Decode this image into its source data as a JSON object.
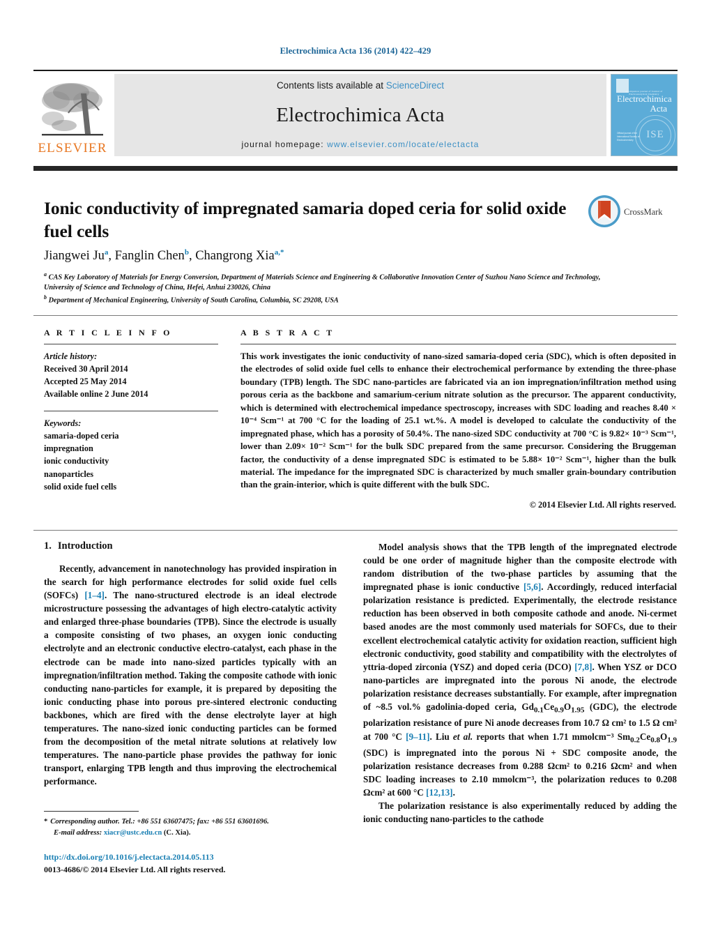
{
  "running_head": "Electrochimica Acta 136 (2014) 422–429",
  "masthead": {
    "publisher": "ELSEVIER",
    "contents_prefix": "Contents lists available at ",
    "contents_link": "ScienceDirect",
    "journal_title": "Electrochimica Acta",
    "homepage_prefix": "journal homepage: ",
    "homepage_url": "www.elsevier.com/locate/electacta",
    "cover": {
      "line1": "Electrochimica",
      "line2": "Acta",
      "tiny_top": "a companion journal of Journal of Electroanalytical Chemistry",
      "tiny_blurb": "Official journal of the International Society of Electrochemistry",
      "society": "ISE"
    }
  },
  "article": {
    "title": "Ionic conductivity of impregnated samaria doped ceria for solid oxide fuel cells",
    "crossmark_label": "CrossMark",
    "authors_html": "Jiangwei Ju<sup>a</sup>, Fanglin Chen<sup>b</sup>, Changrong Xia<sup>a,*</sup>",
    "affiliation_a": "CAS Key Laboratory of Materials for Energy Conversion, Department of Materials Science and Engineering & Collaborative Innovation Center of Suzhou Nano Science and Technology, University of Science and Technology of China, Hefei, Anhui 230026, China",
    "affiliation_b": "Department of Mechanical Engineering, University of South Carolina, Columbia, SC 29208, USA"
  },
  "article_info": {
    "heading": "A R T I C L E   I N F O",
    "history_title": "Article history:",
    "history": [
      "Received 30 April 2014",
      "Accepted 25 May 2014",
      "Available online 2 June 2014"
    ],
    "keywords_title": "Keywords:",
    "keywords": [
      "samaria-doped ceria",
      "impregnation",
      "ionic conductivity",
      "nanoparticles",
      "solid oxide fuel cells"
    ]
  },
  "abstract": {
    "heading": "A B S T R A C T",
    "text": "This work investigates the ionic conductivity of nano-sized samaria-doped ceria (SDC), which is often deposited in the electrodes of solid oxide fuel cells to enhance their electrochemical performance by extending the three-phase boundary (TPB) length. The SDC nano-particles are fabricated via an ion impregnation/infiltration method using porous ceria as the backbone and samarium-cerium nitrate solution as the precursor. The apparent conductivity, which is determined with electrochemical impedance spectroscopy, increases with SDC loading and reaches 8.40 × 10⁻⁴ Scm⁻¹ at 700 °C for the loading of 25.1 wt.%. A model is developed to calculate the conductivity of the impregnated phase, which has a porosity of 50.4%. The nano-sized SDC conductivity at 700 °C is 9.82× 10⁻³ Scm⁻¹, lower than 2.09× 10⁻² Scm⁻¹ for the bulk SDC prepared from the same precursor. Considering the Bruggeman factor, the conductivity of a dense impregnated SDC is estimated to be 5.88× 10⁻² Scm⁻¹, higher than the bulk material. The impedance for the impregnated SDC is characterized by much smaller grain-boundary contribution than the grain-interior, which is quite different with the bulk SDC.",
    "copyright": "© 2014 Elsevier Ltd. All rights reserved."
  },
  "body": {
    "section_number": "1.",
    "section_title": "Introduction",
    "left_paragraph_1": "Recently, advancement in nanotechnology has provided inspiration in the search for high performance electrodes for solid oxide fuel cells (SOFCs) [1–4]. The nano-structured electrode is an ideal electrode microstructure possessing the advantages of high electro-catalytic activity and enlarged three-phase boundaries (TPB). Since the electrode is usually a composite consisting of two phases, an oxygen ionic conducting electrolyte and an electronic conductive electro-catalyst, each phase in the electrode can be made into nano-sized particles typically with an impregnation/infiltration method. Taking the composite cathode with ionic conducting nano-particles for example, it is prepared by depositing the ionic conducting phase into porous pre-sintered electronic conducting backbones, which are fired with the dense electrolyte layer at high temperatures. The nano-sized ionic conducting particles can be formed from the decomposition of the metal nitrate solutions at relatively low temperatures. The nano-particle phase provides the pathway for ionic transport, enlarging TPB length and thus improving the electrochemical performance.",
    "right_paragraph_1": "Model analysis shows that the TPB length of the impregnated electrode could be one order of magnitude higher than the composite electrode with random distribution of the two-phase particles by assuming that the impregnated phase is ionic conductive [5,6]. Accordingly, reduced interfacial polarization resistance is predicted. Experimentally, the electrode resistance reduction has been observed in both composite cathode and anode. Ni-cermet based anodes are the most commonly used materials for SOFCs, due to their excellent electrochemical catalytic activity for oxidation reaction, sufficient high electronic conductivity, good stability and compatibility with the electrolytes of yttria-doped zirconia (YSZ) and doped ceria (DCO) [7,8]. When YSZ or DCO nano-particles are impregnated into the porous Ni anode, the electrode polarization resistance decreases substantially. For example, after impregnation of ~8.5 vol.% gadolinia-doped ceria, Gd0.1Ce0.9O1.95 (GDC), the electrode polarization resistance of pure Ni anode decreases from 10.7 Ω cm² to 1.5 Ω cm² at 700 °C [9–11]. Liu et al. reports that when 1.71 mmolcm⁻³ Sm0.2Ce0.8O1.9 (SDC) is impregnated into the porous Ni + SDC composite anode, the polarization resistance decreases from 0.288 Ωcm² to 0.216 Ωcm² and when SDC loading increases to 2.10 mmolcm⁻³, the polarization reduces to 0.208 Ωcm² at 600 °C [12,13].",
    "right_paragraph_2": "The polarization resistance is also experimentally reduced by adding the ionic conducting nano-particles to the cathode"
  },
  "footnote": {
    "star": "*",
    "corresponding": "Corresponding author. Tel.: +86 551 63607475; fax: +86 551 63601696.",
    "email_label": "E-mail address:",
    "email": "xiacr@ustc.edu.cn",
    "email_suffix": "(C. Xia)."
  },
  "footer": {
    "doi": "http://dx.doi.org/10.1016/j.electacta.2014.05.113",
    "issn": "0013-4686/© 2014 Elsevier Ltd. All rights reserved."
  },
  "colors": {
    "link": "#1a7fb3",
    "sciencedirect": "#3b8fc4",
    "elsevier_orange": "#E87722",
    "cover_blue": "#5cacd8"
  }
}
